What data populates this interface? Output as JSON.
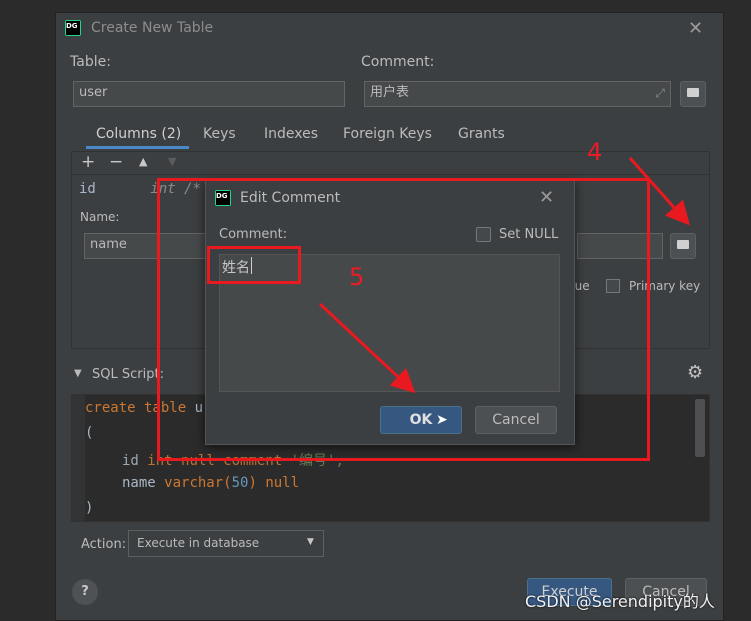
{
  "main_dialog": {
    "title": "Create New Table",
    "table_label": "Table:",
    "table_value": "user",
    "comment_label": "Comment:",
    "comment_value": "用户表",
    "tabs": [
      {
        "label": "Columns (2)",
        "active": true
      },
      {
        "label": "Keys",
        "active": false
      },
      {
        "label": "Indexes",
        "active": false
      },
      {
        "label": "Foreign Keys",
        "active": false
      },
      {
        "label": "Grants",
        "active": false
      }
    ],
    "toolbar": {
      "add": "+",
      "remove": "−",
      "up": "▲",
      "down": "▼"
    },
    "column_preview": {
      "name": "id",
      "type": "int /*"
    },
    "name_label": "Name:",
    "name_value": "name",
    "unique_label": "que",
    "primary_key_label": "Primary key",
    "sql_script_label": "SQL Script:",
    "code": {
      "l1_kw": "create table",
      "l1_rest": "u",
      "l2": "(",
      "l3_id": "id",
      "l3_type": "int",
      "l3_rest": "null comment",
      "l3_str": "'编号',",
      "l4_name": "name",
      "l4_type": "varchar(",
      "l4_num": "50",
      "l4_close": ")",
      "l4_null": "null",
      "l5": ")"
    },
    "action_label": "Action:",
    "action_value": "Execute in database",
    "help": "?",
    "execute": "Execute",
    "cancel": "Cancel"
  },
  "edit_comment_dialog": {
    "title": "Edit Comment",
    "comment_label": "Comment:",
    "set_null_label": "Set NULL",
    "set_null_checked": false,
    "text": "姓名",
    "ok": "OK",
    "cancel": "Cancel"
  },
  "annotations": {
    "step4": "4",
    "step5": "5",
    "color": "#e8191f"
  },
  "watermark": "CSDN @Serendipity的人",
  "colors": {
    "dialog_bg": "#3c3f41",
    "primary_button": "#365880",
    "accent_tab": "#4a88c7"
  }
}
